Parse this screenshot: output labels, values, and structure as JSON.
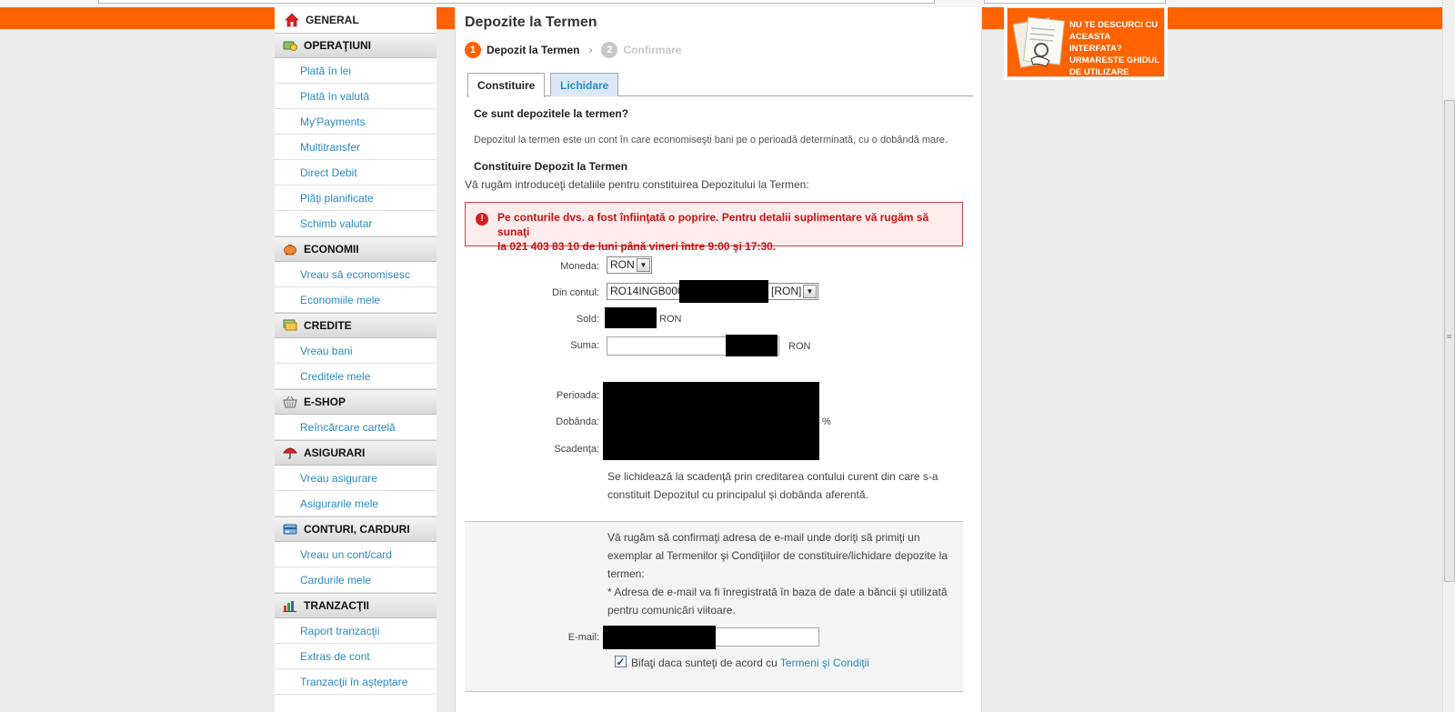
{
  "sidebar": {
    "general": "GENERAL",
    "categories": [
      {
        "title": "OPERAŢIUNI",
        "icon": "operations-icon",
        "items": [
          "Plată în lei",
          "Plată în valută",
          "My'Payments",
          "Multitransfer",
          "Direct Debit",
          "Plăţi planificate",
          "Schimb valutar"
        ]
      },
      {
        "title": "ECONOMII",
        "icon": "piggy-bank-icon",
        "items": [
          "Vreau să economisesc",
          "Economiile mele"
        ]
      },
      {
        "title": "CREDITE",
        "icon": "money-icon",
        "items": [
          "Vreau bani",
          "Creditele mele"
        ]
      },
      {
        "title": "E-SHOP",
        "icon": "basket-icon",
        "items": [
          "Reîncărcare cartelă"
        ]
      },
      {
        "title": "ASIGURARI",
        "icon": "umbrella-icon",
        "items": [
          "Vreau asigurare",
          "Asigurarile mele"
        ]
      },
      {
        "title": "CONTURI, CARDURI",
        "icon": "card-icon",
        "items": [
          "Vreau un cont/card",
          "Cardurile mele"
        ]
      },
      {
        "title": "TRANZACŢII",
        "icon": "chart-icon",
        "items": [
          "Raport tranzacţii",
          "Extras de cont",
          "Tranzacţii în aşteptare"
        ]
      }
    ]
  },
  "main": {
    "title": "Depozite la Termen",
    "steps": [
      {
        "num": "1",
        "label": "Depozit la Termen"
      },
      {
        "num": "2",
        "label": "Confirmare"
      }
    ],
    "tabs": [
      "Constituire",
      "Lichidare"
    ],
    "what_heading": "Ce sunt depozitele la termen?",
    "what_text": "Depozitul la termen este un cont în care economiseşti bani pe o perioadă determinată, cu o dobândă mare.",
    "form_heading": "Constituire Depozit la Termen",
    "form_intro": "Vă rugăm introduceţi detaliile pentru constituirea Depozitului la Termen:",
    "alert_line1": "Pe conturile dvs. a fost înfiinţată o poprire. Pentru detalii suplimentare vă rugăm să sunaţi",
    "alert_line2": "la 021 403 83 10 de luni până vineri între 9:00 şi 17:30.",
    "labels": {
      "moneda": "Moneda:",
      "din_contul": "Din contul:",
      "sold": "Sold:",
      "suma": "Suma:",
      "perioada": "Perioada:",
      "dobanda": "Dobânda:",
      "scadenta": "Scadenţa:",
      "email": "E-mail:"
    },
    "currency_value": "RON",
    "account_prefix": "RO14INGB000",
    "account_suffix": "[RON]",
    "sold_unit": "RON",
    "suma_unit": "RON",
    "percent": "%",
    "settlement_line1": "Se lichidează la scadenţă prin creditarea contului curent din care s-a",
    "settlement_line2": "constituit Depozitul cu principalul şi dobânda aferentă.",
    "email_lines": [
      "Vă rugăm să confirmaţi adresa de e-mail unde doriţi să primiţi un",
      "exemplar al Termenilor şi Condiţiilor de constituire/lichidare depozite la",
      "termen:",
      "* Adresa de e-mail va fi înregistrată în baza de date a băncii şi utilizată",
      "pentru comunicări viitoare."
    ],
    "agree_text": "Bifaţi daca sunteţi de acord cu ",
    "agree_link": "Termeni şi Condiţii"
  },
  "promo": {
    "line1": "NU TE DESCURCI CU",
    "line2": "ACEASTA INTERFATA?",
    "line3": "URMARESTE GHIDUL",
    "line4": "DE UTILIZARE"
  },
  "colors": {
    "brand_orange": "#ff6200",
    "link_blue": "#2a8ac4",
    "alert_red": "#cc1010"
  }
}
